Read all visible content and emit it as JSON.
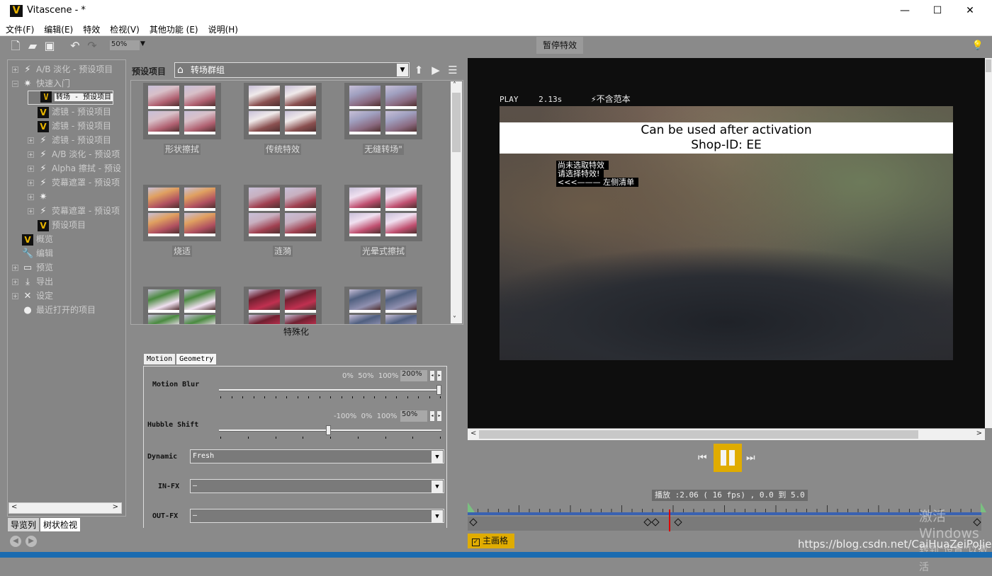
{
  "window": {
    "title": "Vitascene - *",
    "logo": "V",
    "controls": [
      "—",
      "☐",
      "✕"
    ]
  },
  "menu": [
    "文件(F)",
    "编辑(E)",
    "特效",
    "检视(V)",
    "其他功能 (E)",
    "说明(H)"
  ],
  "toolbar": {
    "zoom": "50%",
    "pause_fx": "暂停特效",
    "icons": [
      "new-file-icon",
      "open-folder-icon",
      "save-icon",
      "undo-icon",
      "redo-icon",
      "lightbulb-icon"
    ]
  },
  "tree": {
    "items": [
      {
        "label": "A/B 淡化 - 预设项目",
        "icon": "lightning",
        "expander": "+",
        "level": 0
      },
      {
        "label": "快速入门",
        "icon": "sparkle",
        "expander": "−",
        "level": 0
      },
      {
        "label": "转场 - 预设项目",
        "icon": "v",
        "level": 1,
        "selected": true
      },
      {
        "label": "滤镜 - 预设项目",
        "icon": "v",
        "level": 1
      },
      {
        "label": "滤镜 - 预设项目",
        "icon": "v",
        "level": 1
      },
      {
        "label": "滤镜 - 预设项目",
        "icon": "lightning",
        "expander": "+",
        "level": 1
      },
      {
        "label": "A/B 淡化 - 预设项",
        "icon": "lightning",
        "expander": "+",
        "level": 1
      },
      {
        "label": "Alpha 擦拭 - 预设",
        "icon": "lightning",
        "expander": "+",
        "level": 1
      },
      {
        "label": "荧幕遮罩 - 预设项",
        "icon": "lightning",
        "expander": "+",
        "level": 1
      },
      {
        "label": "",
        "icon": "sparkle",
        "expander": "+",
        "level": 1
      },
      {
        "label": "荧幕遮罩 - 预设项",
        "icon": "lightning",
        "expander": "+",
        "level": 1
      },
      {
        "label": "预设项目",
        "icon": "v",
        "level": 1
      },
      {
        "label": "概览",
        "icon": "v",
        "level": 0
      },
      {
        "label": "编辑",
        "icon": "wrench",
        "level": 0
      },
      {
        "label": "预览",
        "icon": "monitor",
        "expander": "+",
        "level": 0
      },
      {
        "label": "导出",
        "icon": "download",
        "expander": "+",
        "level": 0
      },
      {
        "label": "设定",
        "icon": "tools",
        "expander": "+",
        "level": 0
      },
      {
        "label": "最近打开的项目",
        "icon": "pin",
        "level": 0
      }
    ],
    "tabs": [
      "导览列",
      "树状检视"
    ]
  },
  "presets": {
    "label": "预设项目",
    "group": "转场群组",
    "tiles": [
      "形状擦拭",
      "传统特效",
      "无缝转场\"",
      "烧适",
      "涟漪",
      "光晕式擦拭",
      "",
      "",
      ""
    ],
    "footer": "特殊化"
  },
  "motion": {
    "tabs": [
      "Motion",
      "Geometry"
    ],
    "motion_blur": {
      "label": "Motion Blur",
      "scale": [
        "0%",
        "50%",
        "100%"
      ],
      "value": "200%",
      "fraction": 1.0
    },
    "hubble_shift": {
      "label": "Hubble Shift",
      "scale": [
        "-100%",
        "0%",
        "100%"
      ],
      "value": "50%",
      "fraction": 0.5
    },
    "dynamic": {
      "label": "Dynamic",
      "value": "Fresh"
    },
    "in_fx": {
      "label": "IN-FX",
      "value": "—"
    },
    "out_fx": {
      "label": "OUT-FX",
      "value": "—"
    }
  },
  "preview": {
    "mode": "PLAY",
    "time": "2.13s",
    "template": "不含范本",
    "banner_line1": "Can be used after activation",
    "banner_line2": "Shop-ID:  EE",
    "notice": [
      "尚未选取特效",
      "请选择特效!",
      "<<<——— 左侧清单"
    ]
  },
  "playback": {
    "status": "播放 :2.06 ( 16 fps) , 0.0 到 5.0",
    "range": [
      0.0,
      5.0
    ],
    "position": 2.06,
    "keyframes": [
      0.0,
      1.75,
      1.83,
      2.05,
      5.0
    ]
  },
  "master_grid": {
    "label": "主画格",
    "checked": true
  },
  "watermark": {
    "line1": "激活 Windows",
    "line2": "转到\"设置\"以激活"
  },
  "url": "https://blog.csdn.net/CaiHuaZeiPoJie",
  "colors": {
    "accent": "#e0ac00",
    "timeline": "#3a62b0",
    "playhead": "#dd0000",
    "panel": "#8a8a8a"
  }
}
